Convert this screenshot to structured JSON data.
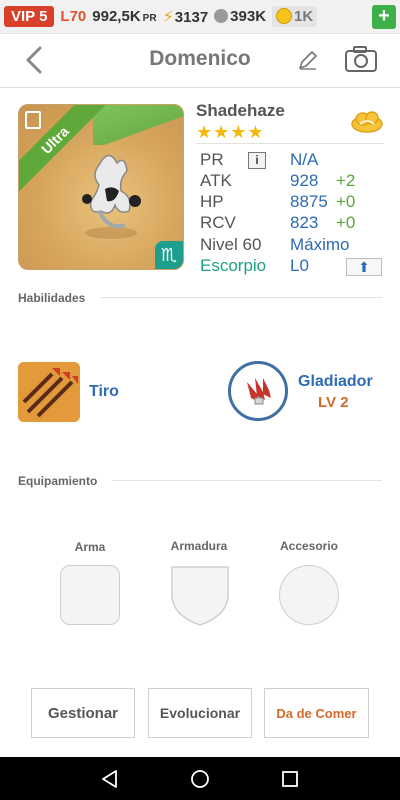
{
  "topbar": {
    "vip": "VIP 5",
    "level": "L70",
    "pr_value": "992,5K",
    "pr_label": "PR",
    "energy": "3137",
    "paw": "393K",
    "coins": "1K",
    "plus": "+"
  },
  "header": {
    "title": "Domenico"
  },
  "character": {
    "rarity": "Ultra",
    "name": "Shadehaze",
    "stars": "★★★★",
    "zodiac_symbol": "♏",
    "stats": {
      "pr_label": "PR",
      "pr_value": "N/A",
      "info": "i",
      "atk_label": "ATK",
      "atk_value": "928",
      "atk_bonus": "+2",
      "hp_label": "HP",
      "hp_value": "8875",
      "hp_bonus": "+0",
      "rcv_label": "RCV",
      "rcv_value": "823",
      "rcv_bonus": "+0",
      "level_label": "Nivel 60",
      "level_value": "Máximo",
      "zodiac_label": "Escorpio",
      "zodiac_value": "L0",
      "upgrade": "⬆"
    }
  },
  "abilities": {
    "heading": "Habilidades",
    "skill_name": "Tiro",
    "gladiator_name": "Gladiador",
    "gladiator_level": "LV 2"
  },
  "equipment": {
    "heading": "Equipamiento",
    "weapon": "Arma",
    "armor": "Armadura",
    "accessory": "Accesorio"
  },
  "actions": {
    "manage": "Gestionar",
    "evolve": "Evolucionar",
    "feed": "Da de Comer"
  },
  "colors": {
    "accent_blue": "#2e6bb5",
    "bonus_green": "#5aa53c",
    "feed_orange": "#d6692a",
    "vip_red": "#d8402a"
  }
}
